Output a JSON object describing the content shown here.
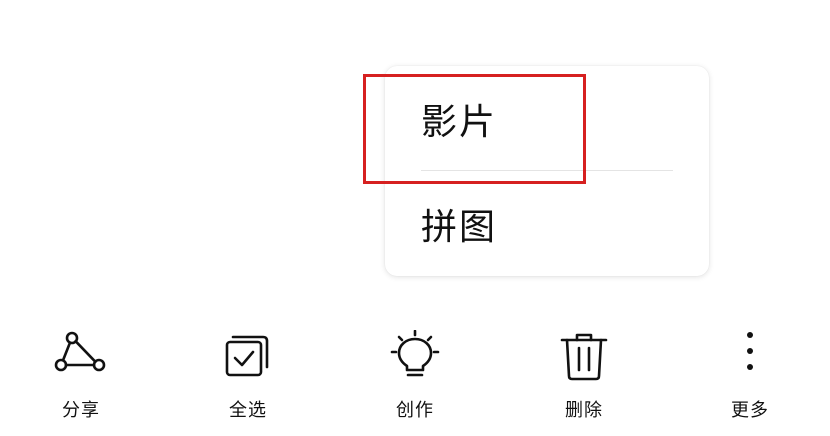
{
  "popup_menu": {
    "items": [
      {
        "label": "影片"
      },
      {
        "label": "拼图"
      }
    ]
  },
  "toolbar": {
    "share_label": "分享",
    "select_all_label": "全选",
    "create_label": "创作",
    "delete_label": "删除",
    "more_label": "更多"
  },
  "colors": {
    "highlight": "#d62020",
    "icon_stroke": "#111111"
  },
  "icons": {
    "share": "share-icon",
    "select_all": "select-all-icon",
    "create": "lightbulb-icon",
    "delete": "trash-icon",
    "more": "more-vertical-icon"
  }
}
